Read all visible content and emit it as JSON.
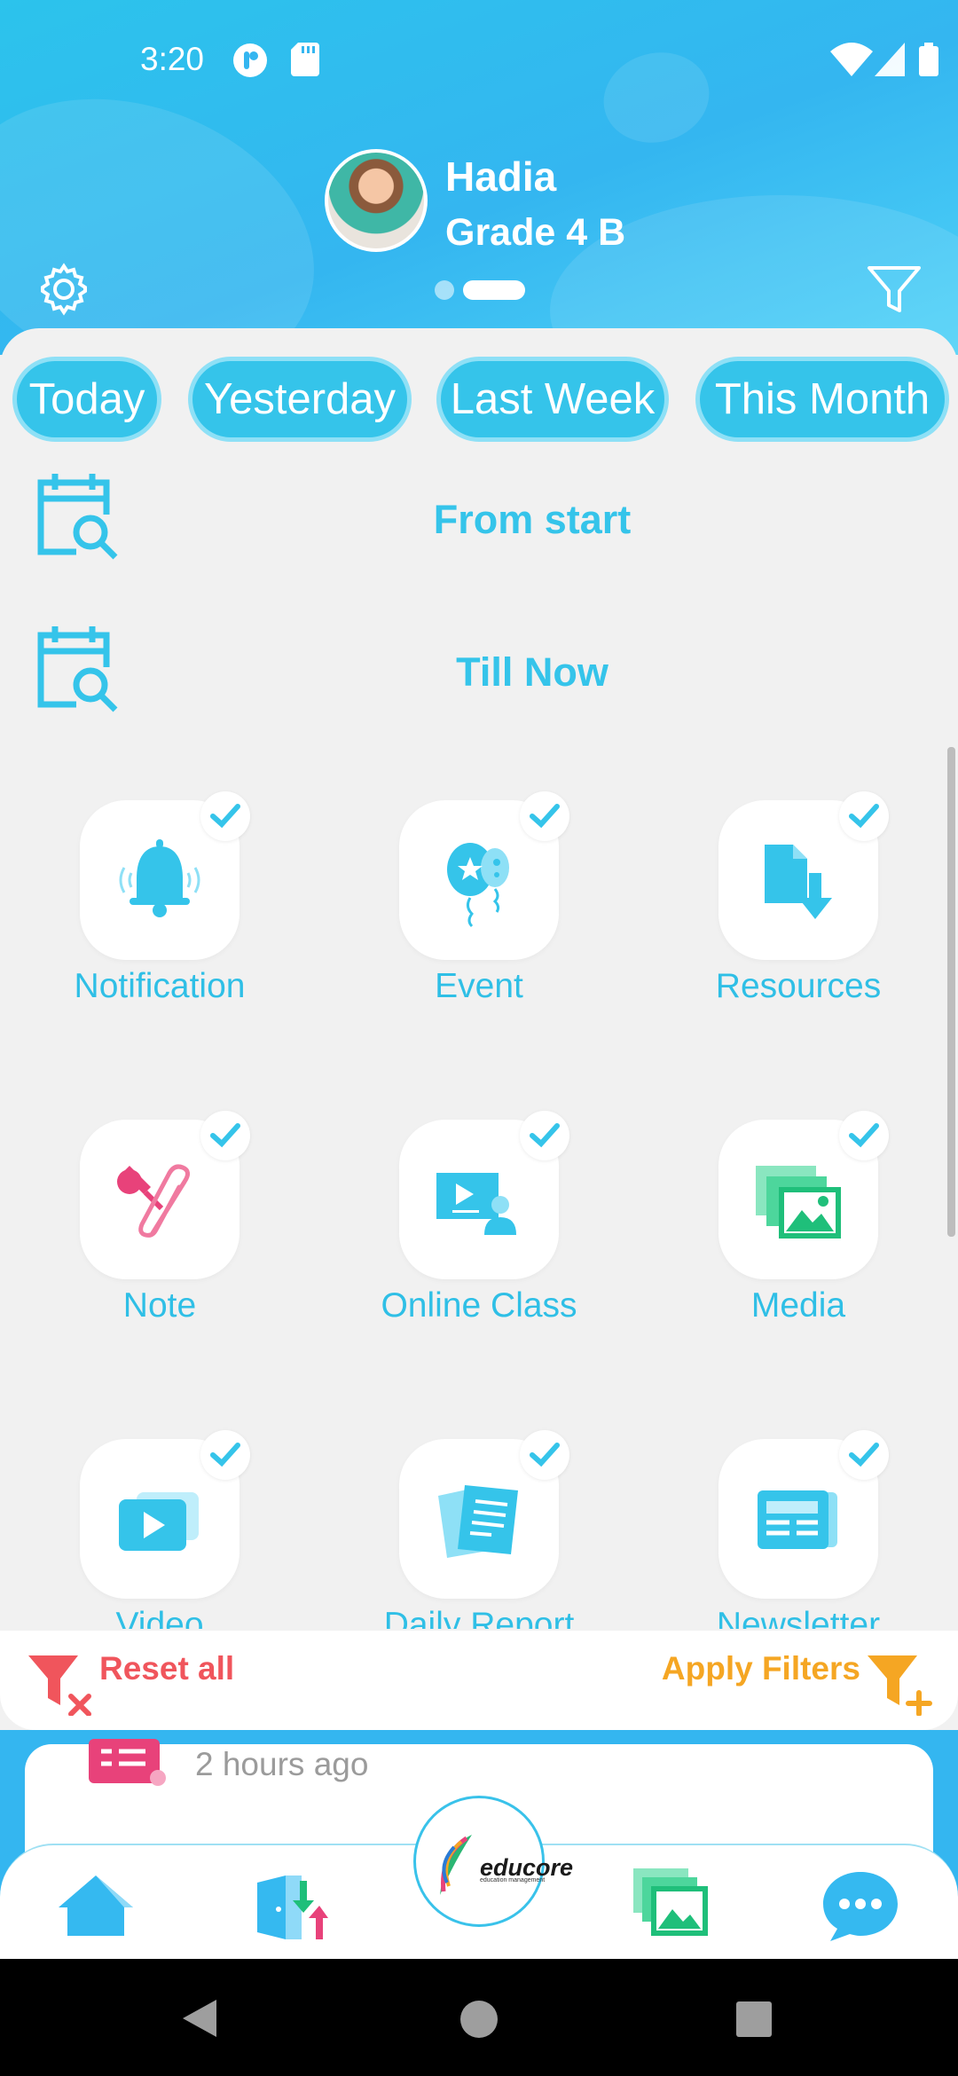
{
  "status_bar": {
    "time": "3:20"
  },
  "profile": {
    "name": "Hadia",
    "grade": "Grade 4 B"
  },
  "quick_filters": [
    "Today",
    "Yesterday",
    "Last Week",
    "This Month"
  ],
  "date_range": {
    "from": "From start",
    "to": "Till Now"
  },
  "categories": [
    {
      "label": "Notification",
      "icon": "bell-icon",
      "checked": true
    },
    {
      "label": "Event",
      "icon": "balloons-icon",
      "checked": true
    },
    {
      "label": "Resources",
      "icon": "file-download-icon",
      "checked": true
    },
    {
      "label": "Note",
      "icon": "pin-paperclip-icon",
      "checked": true
    },
    {
      "label": "Online Class",
      "icon": "online-class-icon",
      "checked": true
    },
    {
      "label": "Media",
      "icon": "gallery-icon",
      "checked": true
    },
    {
      "label": "Video",
      "icon": "video-play-icon",
      "checked": true
    },
    {
      "label": "Daily Report",
      "icon": "report-icon",
      "checked": true
    },
    {
      "label": "Newsletter",
      "icon": "newsletter-icon",
      "checked": true
    }
  ],
  "actions": {
    "reset": "Reset all",
    "apply": "Apply Filters"
  },
  "feed": {
    "time": "2 hours ago"
  },
  "logo": {
    "name": "educore",
    "tagline": "education management"
  },
  "colors": {
    "accent": "#35c4ea",
    "reset": "#f0555c",
    "apply": "#f5a623"
  }
}
